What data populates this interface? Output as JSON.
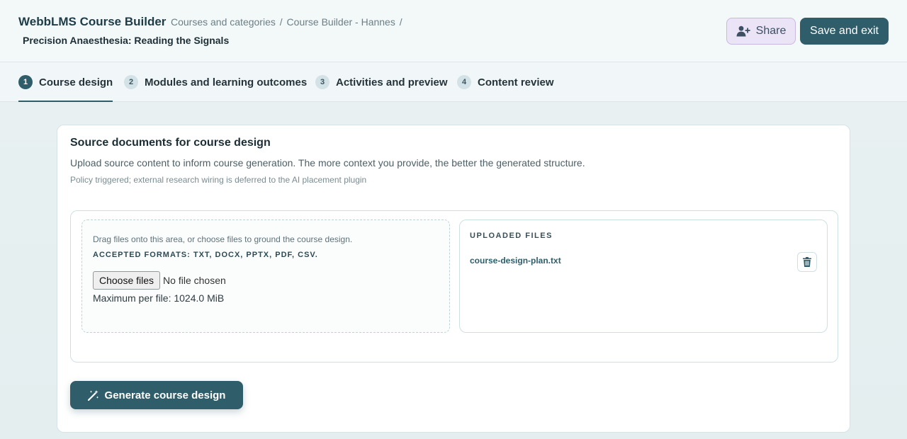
{
  "header": {
    "app_title": "WebbLMS Course Builder",
    "breadcrumb": [
      "Courses and categories",
      "Course Builder - Hannes"
    ],
    "breadcrumb_separator": "/",
    "course_title": "Precision Anaesthesia: Reading the Signals",
    "share_label": "Share",
    "share_icon": "user-plus-icon",
    "save_exit_label": "Save and exit"
  },
  "tabs": [
    {
      "number": "1",
      "label": "Course design",
      "active": true
    },
    {
      "number": "2",
      "label": "Modules and learning outcomes",
      "active": false
    },
    {
      "number": "3",
      "label": "Activities and preview",
      "active": false
    },
    {
      "number": "4",
      "label": "Content review",
      "active": false
    }
  ],
  "main": {
    "title": "Source documents for course design",
    "description": "Upload source content to inform course generation. The more context you provide, the better the generated structure.",
    "note": "Policy triggered; external research wiring is deferred to the AI placement plugin",
    "dropzone": {
      "hint": "Drag files onto this area, or choose files to ground the course design.",
      "formats": "ACCEPTED FORMATS: TXT, DOCX, PPTX, PDF, CSV.",
      "choose_label": "Choose files",
      "no_file": "No file chosen",
      "max_size": "Maximum per file: 1024.0 MiB"
    },
    "uploaded": {
      "title": "UPLOADED FILES",
      "files": [
        {
          "name": "course-design-plan.txt",
          "delete_icon": "trash-icon"
        }
      ]
    },
    "generate_label": "Generate course design",
    "generate_icon": "magic-wand-icon"
  },
  "colors": {
    "primary": "#2f5d6a",
    "share_bg": "#ebe3f6",
    "page_bg": "#e9f1f2"
  }
}
